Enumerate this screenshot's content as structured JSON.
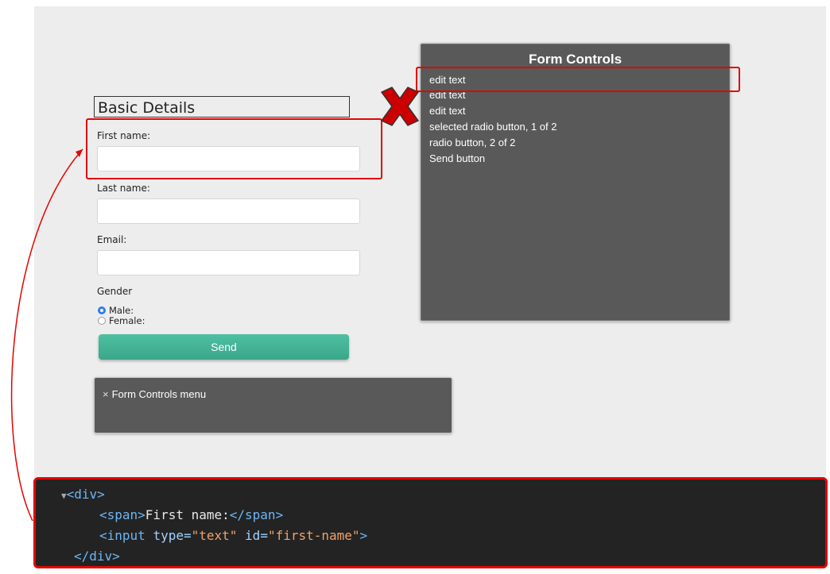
{
  "form": {
    "legend": "Basic Details",
    "first_name_label": "First name:",
    "last_name_label": "Last name:",
    "email_label": "Email:",
    "gender_label": "Gender",
    "gender_options": [
      {
        "label": "Male:",
        "checked": true
      },
      {
        "label": "Female:",
        "checked": false
      }
    ],
    "send_label": "Send"
  },
  "panel": {
    "title": "Form Controls",
    "items": [
      "edit text",
      "edit text",
      "edit text",
      "selected radio button, 1 of 2",
      "radio button, 2 of 2",
      "Send button"
    ]
  },
  "menu": {
    "close_glyph": "×",
    "label": "Form Controls menu"
  },
  "code": {
    "toggle": "▼",
    "div_open": "<div>",
    "span_open": "<span>",
    "span_text": "First name:",
    "span_close": "</span>",
    "input_start": "<input",
    "attr_type": "type=",
    "type_value": "\"text\"",
    "attr_id": "id=",
    "id_value": "\"first-name\"",
    "input_end": ">",
    "div_close": "</div>"
  },
  "colors": {
    "highlight": "#e10600",
    "panel_bg": "#595959",
    "send_bg": "#3aa689",
    "radio_checked": "#2f7fe6"
  },
  "icons": {
    "error_marker": "red-x-icon",
    "menu_close": "close-icon"
  }
}
